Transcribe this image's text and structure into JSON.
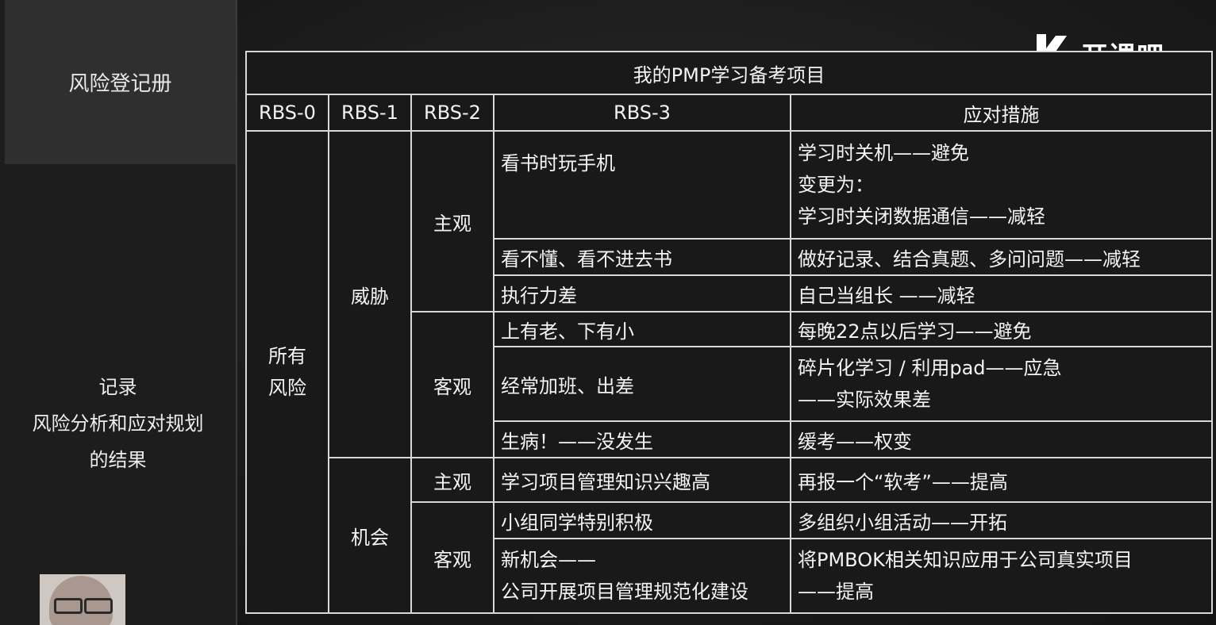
{
  "sidebar": {
    "header": "风险登记册",
    "note_lines": [
      "记录",
      "风险分析和应对规划",
      "的结果"
    ]
  },
  "logo": {
    "text": "开课吧"
  },
  "table": {
    "title": "我的PMP学习备考项目",
    "columns": [
      "RBS-0",
      "RBS-1",
      "RBS-2",
      "RBS-3",
      "应对措施"
    ],
    "rbs0": [
      "所有",
      "风险"
    ],
    "rbs1": [
      "威胁",
      "机会"
    ],
    "rbs2": [
      "主观",
      "客观",
      "主观",
      "客观"
    ],
    "rows": [
      {
        "rbs3": [
          "看书时玩手机"
        ],
        "response": [
          "学习时关机——避免",
          "变更为：",
          "学习时关闭数据通信——减轻"
        ]
      },
      {
        "rbs3": [
          "看不懂、看不进去书"
        ],
        "response": [
          "做好记录、结合真题、多问问题——减轻"
        ]
      },
      {
        "rbs3": [
          "执行力差"
        ],
        "response": [
          "自己当组长 ——减轻"
        ]
      },
      {
        "rbs3": [
          "上有老、下有小"
        ],
        "response": [
          "每晚22点以后学习——避免"
        ]
      },
      {
        "rbs3": [
          "经常加班、出差"
        ],
        "response": [
          "碎片化学习 / 利用pad——应急",
          "——实际效果差"
        ]
      },
      {
        "rbs3": [
          "生病！——没发生"
        ],
        "response": [
          "缓考——权变"
        ]
      },
      {
        "rbs3": [
          "学习项目管理知识兴趣高"
        ],
        "response": [
          "再报一个“软考”——提高"
        ]
      },
      {
        "rbs3": [
          "小组同学特别积极"
        ],
        "response": [
          "多组织小组活动——开拓"
        ]
      },
      {
        "rbs3": [
          "新机会——",
          "公司开展项目管理规范化建设"
        ],
        "response": [
          "将PMBOK相关知识应用于公司真实项目",
          "——提高"
        ]
      }
    ]
  }
}
